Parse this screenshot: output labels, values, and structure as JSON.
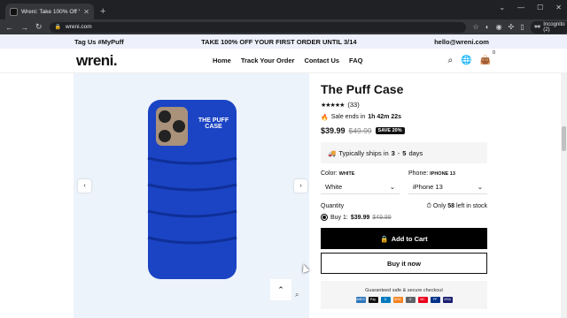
{
  "browser": {
    "tab_title": "Wreni: Take 100% Off Your First ...",
    "url": "wreni.com",
    "profile": "Incognito (2)"
  },
  "announcement": {
    "left": "Tag Us #MyPuff",
    "center": "TAKE 100% OFF YOUR FIRST ORDER UNTIL 3/14",
    "right": "hello@wreni.com"
  },
  "nav": {
    "logo": "wreni.",
    "menu": [
      "Home",
      "Track Your Order",
      "Contact Us",
      "FAQ"
    ],
    "cart_count": "0"
  },
  "product": {
    "title": "The Puff Case",
    "stars": "★★★★★",
    "rating_count": "(33)",
    "sale_prefix": "Sale ends in",
    "sale_timer": "1h 42m 22s",
    "price": "$39.99",
    "compare_price": "$49.99",
    "save_badge": "SAVE 20%",
    "ships_text": "Typically ships in",
    "ships_min": "3",
    "ships_sep": "-",
    "ships_max": "5",
    "ships_unit": "days",
    "color_label": "Color:",
    "color_value_label": "WHITE",
    "color_selected": "White",
    "phone_label": "Phone:",
    "phone_value_label": "IPHONE 13",
    "phone_selected": "iPhone 13",
    "quantity_label": "Quantity",
    "stock_prefix": "Only",
    "stock_count": "58",
    "stock_suffix": "left in stock",
    "bundle_label": "Buy 1:",
    "bundle_price": "$39.99",
    "bundle_compare": "$49.99",
    "add_to_cart": "Add to Cart",
    "buy_now": "Buy it now",
    "secure_text": "Guaranteed safe & secure checkout",
    "case_print": "THE PUFF CASE",
    "case_color": "#1b44c4"
  },
  "payments": [
    {
      "name": "AMEX",
      "color": "#2e77bb"
    },
    {
      "name": "Pay",
      "color": "#111111"
    },
    {
      "name": "D",
      "color": "#0079be"
    },
    {
      "name": "DISC",
      "color": "#f58220"
    },
    {
      "name": "G",
      "color": "#5f6368"
    },
    {
      "name": "MC",
      "color": "#eb001b"
    },
    {
      "name": "PP",
      "color": "#003087"
    },
    {
      "name": "VISA",
      "color": "#1a1f71"
    }
  ]
}
